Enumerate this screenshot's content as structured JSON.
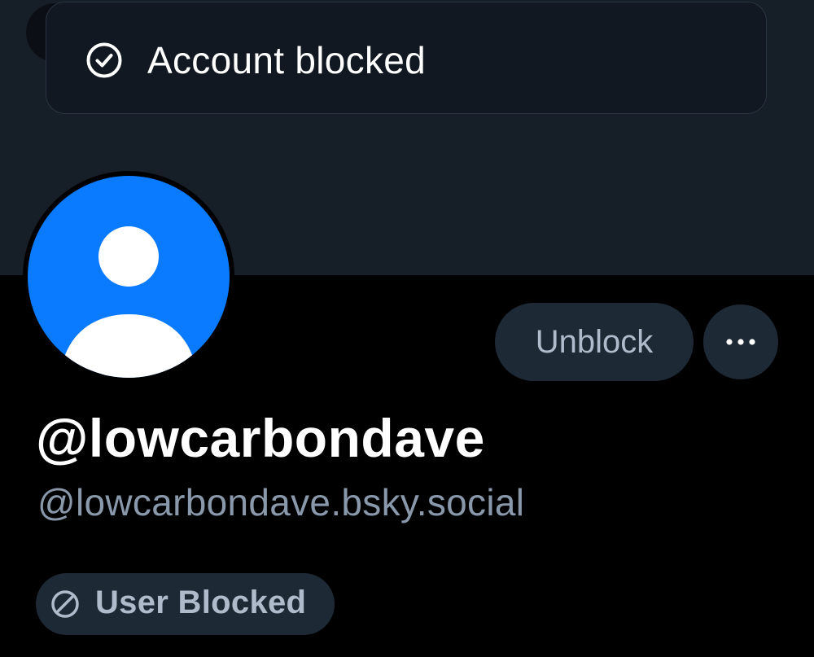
{
  "toast": {
    "message": "Account blocked",
    "icon": "check-circle-icon"
  },
  "profile": {
    "display_name": "@lowcarbondave",
    "handle": "@lowcarbondave.bsky.social",
    "avatar_color": "#0a7aff"
  },
  "actions": {
    "unblock_label": "Unblock",
    "more_icon": "ellipsis-icon"
  },
  "status": {
    "blocked_label": "User Blocked",
    "icon": "ban-icon"
  },
  "colors": {
    "background": "#000000",
    "banner": "#161e27",
    "secondary_button": "#1e2936",
    "muted_text": "#8998aa"
  }
}
